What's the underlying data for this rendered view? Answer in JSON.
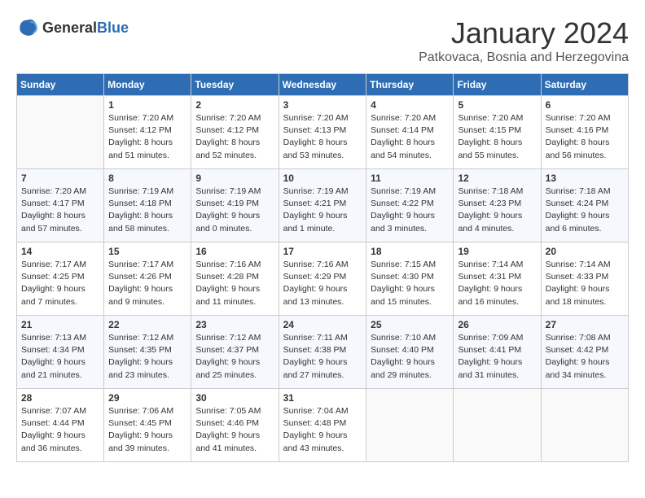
{
  "logo": {
    "general": "General",
    "blue": "Blue"
  },
  "title": {
    "month_year": "January 2024",
    "location": "Patkovaca, Bosnia and Herzegovina"
  },
  "weekdays": [
    "Sunday",
    "Monday",
    "Tuesday",
    "Wednesday",
    "Thursday",
    "Friday",
    "Saturday"
  ],
  "weeks": [
    [
      {
        "day": "",
        "sunrise": "",
        "sunset": "",
        "daylight": ""
      },
      {
        "day": "1",
        "sunrise": "Sunrise: 7:20 AM",
        "sunset": "Sunset: 4:12 PM",
        "daylight": "Daylight: 8 hours and 51 minutes."
      },
      {
        "day": "2",
        "sunrise": "Sunrise: 7:20 AM",
        "sunset": "Sunset: 4:12 PM",
        "daylight": "Daylight: 8 hours and 52 minutes."
      },
      {
        "day": "3",
        "sunrise": "Sunrise: 7:20 AM",
        "sunset": "Sunset: 4:13 PM",
        "daylight": "Daylight: 8 hours and 53 minutes."
      },
      {
        "day": "4",
        "sunrise": "Sunrise: 7:20 AM",
        "sunset": "Sunset: 4:14 PM",
        "daylight": "Daylight: 8 hours and 54 minutes."
      },
      {
        "day": "5",
        "sunrise": "Sunrise: 7:20 AM",
        "sunset": "Sunset: 4:15 PM",
        "daylight": "Daylight: 8 hours and 55 minutes."
      },
      {
        "day": "6",
        "sunrise": "Sunrise: 7:20 AM",
        "sunset": "Sunset: 4:16 PM",
        "daylight": "Daylight: 8 hours and 56 minutes."
      }
    ],
    [
      {
        "day": "7",
        "sunrise": "Sunrise: 7:20 AM",
        "sunset": "Sunset: 4:17 PM",
        "daylight": "Daylight: 8 hours and 57 minutes."
      },
      {
        "day": "8",
        "sunrise": "Sunrise: 7:19 AM",
        "sunset": "Sunset: 4:18 PM",
        "daylight": "Daylight: 8 hours and 58 minutes."
      },
      {
        "day": "9",
        "sunrise": "Sunrise: 7:19 AM",
        "sunset": "Sunset: 4:19 PM",
        "daylight": "Daylight: 9 hours and 0 minutes."
      },
      {
        "day": "10",
        "sunrise": "Sunrise: 7:19 AM",
        "sunset": "Sunset: 4:21 PM",
        "daylight": "Daylight: 9 hours and 1 minute."
      },
      {
        "day": "11",
        "sunrise": "Sunrise: 7:19 AM",
        "sunset": "Sunset: 4:22 PM",
        "daylight": "Daylight: 9 hours and 3 minutes."
      },
      {
        "day": "12",
        "sunrise": "Sunrise: 7:18 AM",
        "sunset": "Sunset: 4:23 PM",
        "daylight": "Daylight: 9 hours and 4 minutes."
      },
      {
        "day": "13",
        "sunrise": "Sunrise: 7:18 AM",
        "sunset": "Sunset: 4:24 PM",
        "daylight": "Daylight: 9 hours and 6 minutes."
      }
    ],
    [
      {
        "day": "14",
        "sunrise": "Sunrise: 7:17 AM",
        "sunset": "Sunset: 4:25 PM",
        "daylight": "Daylight: 9 hours and 7 minutes."
      },
      {
        "day": "15",
        "sunrise": "Sunrise: 7:17 AM",
        "sunset": "Sunset: 4:26 PM",
        "daylight": "Daylight: 9 hours and 9 minutes."
      },
      {
        "day": "16",
        "sunrise": "Sunrise: 7:16 AM",
        "sunset": "Sunset: 4:28 PM",
        "daylight": "Daylight: 9 hours and 11 minutes."
      },
      {
        "day": "17",
        "sunrise": "Sunrise: 7:16 AM",
        "sunset": "Sunset: 4:29 PM",
        "daylight": "Daylight: 9 hours and 13 minutes."
      },
      {
        "day": "18",
        "sunrise": "Sunrise: 7:15 AM",
        "sunset": "Sunset: 4:30 PM",
        "daylight": "Daylight: 9 hours and 15 minutes."
      },
      {
        "day": "19",
        "sunrise": "Sunrise: 7:14 AM",
        "sunset": "Sunset: 4:31 PM",
        "daylight": "Daylight: 9 hours and 16 minutes."
      },
      {
        "day": "20",
        "sunrise": "Sunrise: 7:14 AM",
        "sunset": "Sunset: 4:33 PM",
        "daylight": "Daylight: 9 hours and 18 minutes."
      }
    ],
    [
      {
        "day": "21",
        "sunrise": "Sunrise: 7:13 AM",
        "sunset": "Sunset: 4:34 PM",
        "daylight": "Daylight: 9 hours and 21 minutes."
      },
      {
        "day": "22",
        "sunrise": "Sunrise: 7:12 AM",
        "sunset": "Sunset: 4:35 PM",
        "daylight": "Daylight: 9 hours and 23 minutes."
      },
      {
        "day": "23",
        "sunrise": "Sunrise: 7:12 AM",
        "sunset": "Sunset: 4:37 PM",
        "daylight": "Daylight: 9 hours and 25 minutes."
      },
      {
        "day": "24",
        "sunrise": "Sunrise: 7:11 AM",
        "sunset": "Sunset: 4:38 PM",
        "daylight": "Daylight: 9 hours and 27 minutes."
      },
      {
        "day": "25",
        "sunrise": "Sunrise: 7:10 AM",
        "sunset": "Sunset: 4:40 PM",
        "daylight": "Daylight: 9 hours and 29 minutes."
      },
      {
        "day": "26",
        "sunrise": "Sunrise: 7:09 AM",
        "sunset": "Sunset: 4:41 PM",
        "daylight": "Daylight: 9 hours and 31 minutes."
      },
      {
        "day": "27",
        "sunrise": "Sunrise: 7:08 AM",
        "sunset": "Sunset: 4:42 PM",
        "daylight": "Daylight: 9 hours and 34 minutes."
      }
    ],
    [
      {
        "day": "28",
        "sunrise": "Sunrise: 7:07 AM",
        "sunset": "Sunset: 4:44 PM",
        "daylight": "Daylight: 9 hours and 36 minutes."
      },
      {
        "day": "29",
        "sunrise": "Sunrise: 7:06 AM",
        "sunset": "Sunset: 4:45 PM",
        "daylight": "Daylight: 9 hours and 39 minutes."
      },
      {
        "day": "30",
        "sunrise": "Sunrise: 7:05 AM",
        "sunset": "Sunset: 4:46 PM",
        "daylight": "Daylight: 9 hours and 41 minutes."
      },
      {
        "day": "31",
        "sunrise": "Sunrise: 7:04 AM",
        "sunset": "Sunset: 4:48 PM",
        "daylight": "Daylight: 9 hours and 43 minutes."
      },
      {
        "day": "",
        "sunrise": "",
        "sunset": "",
        "daylight": ""
      },
      {
        "day": "",
        "sunrise": "",
        "sunset": "",
        "daylight": ""
      },
      {
        "day": "",
        "sunrise": "",
        "sunset": "",
        "daylight": ""
      }
    ]
  ]
}
